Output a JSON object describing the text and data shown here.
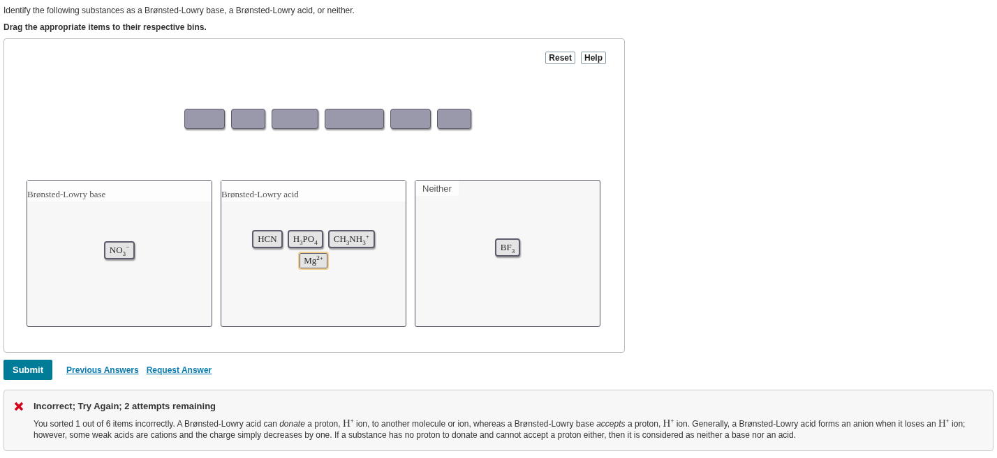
{
  "instructions": "Identify the following substances as a Brønsted-Lowry base, a Brønsted-Lowry acid, or neither.",
  "task": "Drag the appropriate items to their respective bins.",
  "toolbar": [
    "Reset",
    "Help"
  ],
  "bins": [
    {
      "label": "Brønsted-Lowry base",
      "kind": "serif",
      "items": [
        {
          "formula": "NO$_{3}$$^{−}$",
          "flagged": false
        }
      ]
    },
    {
      "label": "Brønsted-Lowry acid",
      "kind": "serif",
      "items": [
        {
          "formula": "HCN",
          "flagged": false
        },
        {
          "formula": "H$_{3}$PO$_{4}$",
          "flagged": false
        },
        {
          "formula": "CH$_{3}$NH$_{3}$$^{+}$",
          "flagged": false
        },
        {
          "formula": "Mg$^{2+}$",
          "flagged": true
        }
      ]
    },
    {
      "label": "Neither",
      "kind": "sans",
      "items": [
        {
          "formula": "BF$_{3}$",
          "flagged": false
        }
      ]
    }
  ],
  "actions": {
    "submit": "Submit",
    "links": [
      "Previous Answers",
      "Request Answer"
    ]
  },
  "feedback": {
    "title": "Incorrect; Try Again; 2 attempts remaining",
    "correct": false,
    "text": "You sorted 1 out of 6 items incorrectly. A Brønsted-Lowry acid can *donate* a proton, H$^{+}$ ion, to another molecule or ion, whereas a Brønsted-Lowry base *accepts* a proton, H$^{+}$ ion. Generally, a Brønsted-Lowry acid forms an anion when it loses an H$^{+}$ ion; however, some weak acids are cations and the charge simply decreases by one. If a substance has no proton to donate and cannot accept a proton either, then it is considered as neither a base nor an acid."
  }
}
